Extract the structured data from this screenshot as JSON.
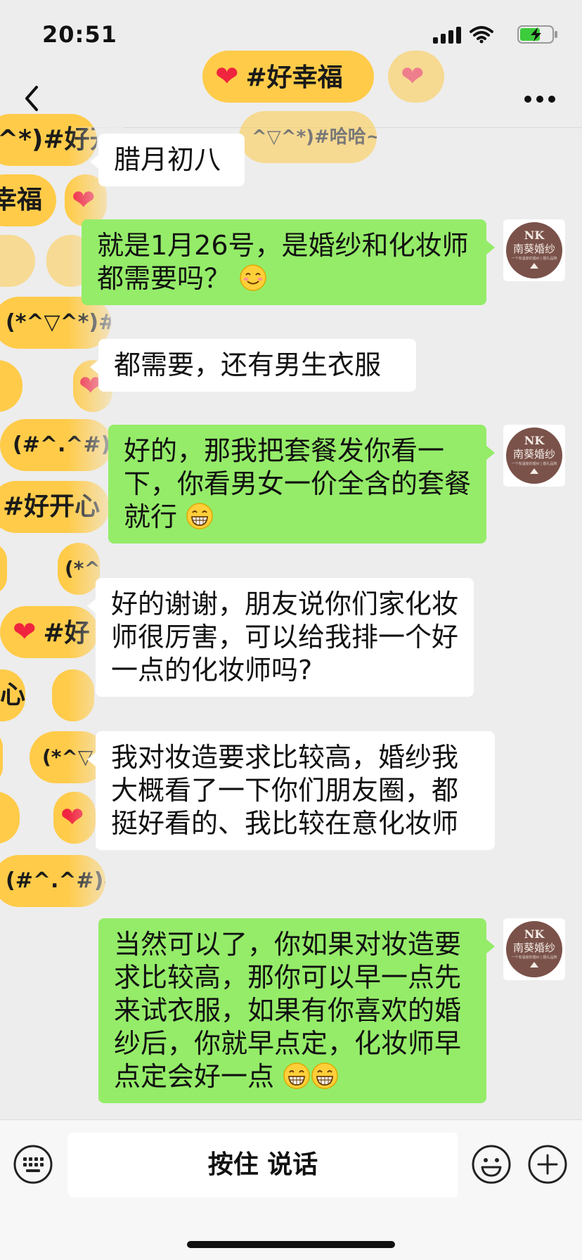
{
  "status_bar": {
    "time": "20:51"
  },
  "header": {
    "effect_pill_top": "#好幸福"
  },
  "effect_pills": {
    "p1": "^*)#好开心",
    "p2": "幸福",
    "p3": "(*^▽^*)#好",
    "p4": "(#^.^#)",
    "p5": "#好开心",
    "p6": "#好",
    "p7": "(*^▽",
    "p8": "(#^.^#)#",
    "p9": "心",
    "p10": "(*^",
    "p11": "^▽^*)#哈哈~"
  },
  "avatar": {
    "initials": "NK",
    "name": "南葵婚纱",
    "tagline": "一个有温度的婚纱 | 婚礼品牌"
  },
  "messages": [
    {
      "side": "in",
      "text": "腊月初八"
    },
    {
      "side": "out",
      "text": "就是1月26号，是婚纱和化妆师都需要吗？",
      "emoji": "smiling-face"
    },
    {
      "side": "in",
      "text": "都需要，还有男生衣服"
    },
    {
      "side": "out",
      "text": "好的，那我把套餐发你看一下，你看男女一价全含的套餐就行",
      "emoji": "grinning-face"
    },
    {
      "side": "in",
      "text": "好的谢谢，朋友说你们家化妆师很厉害，可以给我排一个好一点的化妆师吗?"
    },
    {
      "side": "in",
      "text": "我对妆造要求比较高，婚纱我大概看了一下你们朋友圈，都挺好看的、我比较在意化妆师"
    },
    {
      "side": "out",
      "text": "当然可以了，你如果对妆造要求比较高，那你可以早一点先来试衣服，如果有你喜欢的婚纱后，你就早点定，化妆师早点定会好一点",
      "emoji": "grinning-face x2"
    }
  ],
  "input_bar": {
    "talk_label": "按住 说话"
  },
  "colors": {
    "outgoing_bubble": "#95ec69",
    "incoming_bubble": "#ffffff",
    "effect_pill": "#ffcb49",
    "heart": "#f0243e",
    "background": "#ededed"
  }
}
